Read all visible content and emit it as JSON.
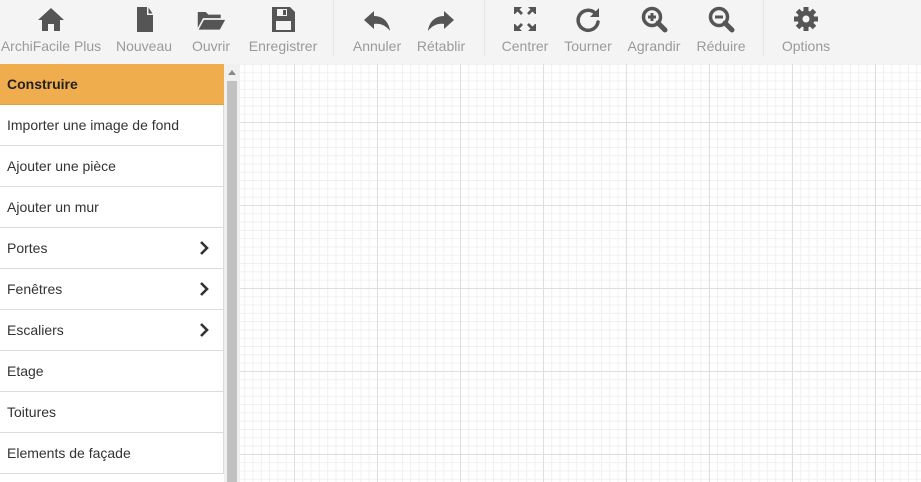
{
  "toolbar": {
    "items": [
      {
        "label": "ArchiFacile Plus",
        "icon": "home-icon"
      },
      {
        "label": "Nouveau",
        "icon": "new-file-icon"
      },
      {
        "label": "Ouvrir",
        "icon": "open-folder-icon"
      },
      {
        "label": "Enregistrer",
        "icon": "save-icon"
      },
      {
        "label": "Annuler",
        "icon": "undo-icon"
      },
      {
        "label": "Rétablir",
        "icon": "redo-icon"
      },
      {
        "label": "Centrer",
        "icon": "expand-icon"
      },
      {
        "label": "Tourner",
        "icon": "rotate-icon"
      },
      {
        "label": "Agrandir",
        "icon": "zoom-in-icon"
      },
      {
        "label": "Réduire",
        "icon": "zoom-out-icon"
      },
      {
        "label": "Options",
        "icon": "gear-icon"
      }
    ]
  },
  "sidebar": {
    "header": "Construire",
    "items": [
      {
        "label": "Importer une image de fond",
        "has_submenu": false
      },
      {
        "label": "Ajouter une pièce",
        "has_submenu": false
      },
      {
        "label": "Ajouter un mur",
        "has_submenu": false
      },
      {
        "label": "Portes",
        "has_submenu": true
      },
      {
        "label": "Fenêtres",
        "has_submenu": true
      },
      {
        "label": "Escaliers",
        "has_submenu": true
      },
      {
        "label": "Etage",
        "has_submenu": false
      },
      {
        "label": "Toitures",
        "has_submenu": false
      },
      {
        "label": "Elements de façade",
        "has_submenu": false
      }
    ]
  },
  "colors": {
    "accent": "#f0ad4e",
    "icon": "#555555",
    "label": "#9a9a9a",
    "grid_major": "#dedede",
    "grid_minor": "#f0f0f0"
  }
}
